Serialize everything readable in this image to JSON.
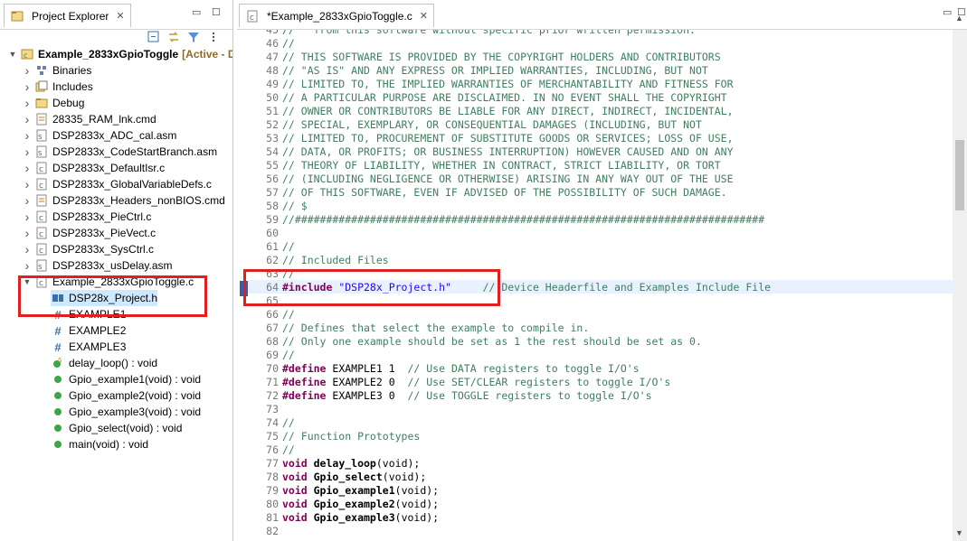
{
  "project_explorer": {
    "title": "Project Explorer",
    "tree": [
      {
        "label": "Example_2833xGpioToggle",
        "suffix": "[Active - D",
        "kind": "project",
        "depth": 0,
        "expanded": true
      },
      {
        "label": "Binaries",
        "kind": "binaries",
        "depth": 1
      },
      {
        "label": "Includes",
        "kind": "includes",
        "depth": 1
      },
      {
        "label": "Debug",
        "kind": "folder",
        "depth": 1
      },
      {
        "label": "28335_RAM_lnk.cmd",
        "kind": "cmd",
        "depth": 1
      },
      {
        "label": "DSP2833x_ADC_cal.asm",
        "kind": "asm",
        "depth": 1
      },
      {
        "label": "DSP2833x_CodeStartBranch.asm",
        "kind": "asm",
        "depth": 1
      },
      {
        "label": "DSP2833x_DefaultIsr.c",
        "kind": "c",
        "depth": 1
      },
      {
        "label": "DSP2833x_GlobalVariableDefs.c",
        "kind": "c",
        "depth": 1
      },
      {
        "label": "DSP2833x_Headers_nonBIOS.cmd",
        "kind": "cmd",
        "depth": 1
      },
      {
        "label": "DSP2833x_PieCtrl.c",
        "kind": "c",
        "depth": 1
      },
      {
        "label": "DSP2833x_PieVect.c",
        "kind": "c",
        "depth": 1
      },
      {
        "label": "DSP2833x_SysCtrl.c",
        "kind": "c",
        "depth": 1
      },
      {
        "label": "DSP2833x_usDelay.asm",
        "kind": "asm",
        "depth": 1
      },
      {
        "label": "Example_2833xGpioToggle.c",
        "kind": "c",
        "depth": 1,
        "expanded": true
      },
      {
        "label": "DSP28x_Project.h",
        "kind": "include",
        "depth": 2,
        "selected": true
      },
      {
        "label": "EXAMPLE1",
        "kind": "hash",
        "depth": 2
      },
      {
        "label": "EXAMPLE2",
        "kind": "hash",
        "depth": 2
      },
      {
        "label": "EXAMPLE3",
        "kind": "hash",
        "depth": 2
      },
      {
        "label": "delay_loop() : void",
        "kind": "func-static",
        "depth": 2
      },
      {
        "label": "Gpio_example1(void) : void",
        "kind": "func",
        "depth": 2
      },
      {
        "label": "Gpio_example2(void) : void",
        "kind": "func",
        "depth": 2
      },
      {
        "label": "Gpio_example3(void) : void",
        "kind": "func",
        "depth": 2
      },
      {
        "label": "Gpio_select(void) : void",
        "kind": "func",
        "depth": 2
      },
      {
        "label": "main(void) : void",
        "kind": "func",
        "depth": 2
      }
    ]
  },
  "editor": {
    "tab_title": "*Example_2833xGpioToggle.c",
    "lines": [
      {
        "n": "45",
        "parts": [
          [
            "c",
            "//   from this software without specific prior written permission."
          ]
        ]
      },
      {
        "n": "46",
        "parts": [
          [
            "c",
            "//"
          ]
        ]
      },
      {
        "n": "47",
        "parts": [
          [
            "c",
            "// THIS SOFTWARE IS PROVIDED BY THE COPYRIGHT HOLDERS AND CONTRIBUTORS"
          ]
        ]
      },
      {
        "n": "48",
        "parts": [
          [
            "c",
            "// \"AS IS\" AND ANY EXPRESS OR IMPLIED WARRANTIES, INCLUDING, BUT NOT"
          ]
        ]
      },
      {
        "n": "49",
        "parts": [
          [
            "c",
            "// LIMITED TO, THE IMPLIED WARRANTIES OF MERCHANTABILITY AND FITNESS FOR"
          ]
        ]
      },
      {
        "n": "50",
        "parts": [
          [
            "c",
            "// A PARTICULAR PURPOSE ARE DISCLAIMED. IN NO EVENT SHALL THE COPYRIGHT"
          ]
        ]
      },
      {
        "n": "51",
        "parts": [
          [
            "c",
            "// OWNER OR CONTRIBUTORS BE LIABLE FOR ANY DIRECT, INDIRECT, INCIDENTAL,"
          ]
        ]
      },
      {
        "n": "52",
        "parts": [
          [
            "c",
            "// SPECIAL, EXEMPLARY, OR CONSEQUENTIAL DAMAGES (INCLUDING, BUT NOT"
          ]
        ]
      },
      {
        "n": "53",
        "parts": [
          [
            "c",
            "// LIMITED TO, PROCUREMENT OF SUBSTITUTE GOODS OR SERVICES; LOSS OF USE,"
          ]
        ]
      },
      {
        "n": "54",
        "parts": [
          [
            "c",
            "// DATA, OR PROFITS; OR BUSINESS INTERRUPTION) HOWEVER CAUSED AND ON ANY"
          ]
        ]
      },
      {
        "n": "55",
        "parts": [
          [
            "c",
            "// THEORY OF LIABILITY, WHETHER IN CONTRACT, STRICT LIABILITY, OR TORT"
          ]
        ]
      },
      {
        "n": "56",
        "parts": [
          [
            "c",
            "// (INCLUDING NEGLIGENCE OR OTHERWISE) ARISING IN ANY WAY OUT OF THE USE"
          ]
        ]
      },
      {
        "n": "57",
        "parts": [
          [
            "c",
            "// OF THIS SOFTWARE, EVEN IF ADVISED OF THE POSSIBILITY OF SUCH DAMAGE."
          ]
        ]
      },
      {
        "n": "58",
        "parts": [
          [
            "c",
            "// $"
          ]
        ]
      },
      {
        "n": "59",
        "parts": [
          [
            "c",
            "//###########################################################################"
          ]
        ]
      },
      {
        "n": "60",
        "parts": []
      },
      {
        "n": "61",
        "parts": [
          [
            "c",
            "//"
          ]
        ]
      },
      {
        "n": "62",
        "parts": [
          [
            "c",
            "// Included Files"
          ]
        ]
      },
      {
        "n": "63",
        "parts": [
          [
            "c",
            "//"
          ]
        ]
      },
      {
        "n": "64",
        "current": true,
        "parts": [
          [
            "k",
            "#include "
          ],
          [
            "s",
            "\"DSP28x_Project.h\""
          ],
          [
            "t",
            "     "
          ],
          [
            "c",
            "// Device Headerfile and Examples Include File"
          ]
        ]
      },
      {
        "n": "65",
        "parts": []
      },
      {
        "n": "66",
        "parts": [
          [
            "c",
            "//"
          ]
        ]
      },
      {
        "n": "67",
        "parts": [
          [
            "c",
            "// Defines that select the example to compile in."
          ]
        ]
      },
      {
        "n": "68",
        "parts": [
          [
            "c",
            "// Only one example should be set as 1 the rest should be set as 0."
          ]
        ]
      },
      {
        "n": "69",
        "parts": [
          [
            "c",
            "//"
          ]
        ]
      },
      {
        "n": "70",
        "parts": [
          [
            "k",
            "#define "
          ],
          [
            "t",
            "EXAMPLE1 1  "
          ],
          [
            "c",
            "// Use DATA registers to toggle I/O's"
          ]
        ]
      },
      {
        "n": "71",
        "parts": [
          [
            "k",
            "#define "
          ],
          [
            "t",
            "EXAMPLE2 0  "
          ],
          [
            "c",
            "// Use SET/CLEAR registers to toggle I/O's"
          ]
        ]
      },
      {
        "n": "72",
        "parts": [
          [
            "k",
            "#define "
          ],
          [
            "t",
            "EXAMPLE3 0  "
          ],
          [
            "c",
            "// Use TOGGLE registers to toggle I/O's"
          ]
        ]
      },
      {
        "n": "73",
        "parts": []
      },
      {
        "n": "74",
        "parts": [
          [
            "c",
            "//"
          ]
        ]
      },
      {
        "n": "75",
        "parts": [
          [
            "c",
            "// Function Prototypes"
          ]
        ]
      },
      {
        "n": "76",
        "parts": [
          [
            "c",
            "//"
          ]
        ]
      },
      {
        "n": "77",
        "parts": [
          [
            "k",
            "void "
          ],
          [
            "b",
            "delay_loop"
          ],
          [
            "t",
            "(void);"
          ]
        ]
      },
      {
        "n": "78",
        "parts": [
          [
            "k",
            "void "
          ],
          [
            "b",
            "Gpio_select"
          ],
          [
            "t",
            "(void);"
          ]
        ]
      },
      {
        "n": "79",
        "parts": [
          [
            "k",
            "void "
          ],
          [
            "b",
            "Gpio_example1"
          ],
          [
            "t",
            "(void);"
          ]
        ]
      },
      {
        "n": "80",
        "parts": [
          [
            "k",
            "void "
          ],
          [
            "b",
            "Gpio_example2"
          ],
          [
            "t",
            "(void);"
          ]
        ]
      },
      {
        "n": "81",
        "parts": [
          [
            "k",
            "void "
          ],
          [
            "b",
            "Gpio_example3"
          ],
          [
            "t",
            "(void);"
          ]
        ]
      },
      {
        "n": "82",
        "parts": []
      }
    ]
  },
  "colors": {
    "highlight_box": "#e02020",
    "selection": "#cde8ff",
    "comment": "#3f7f5f",
    "keyword": "#7f0055",
    "string": "#2a00ff"
  }
}
